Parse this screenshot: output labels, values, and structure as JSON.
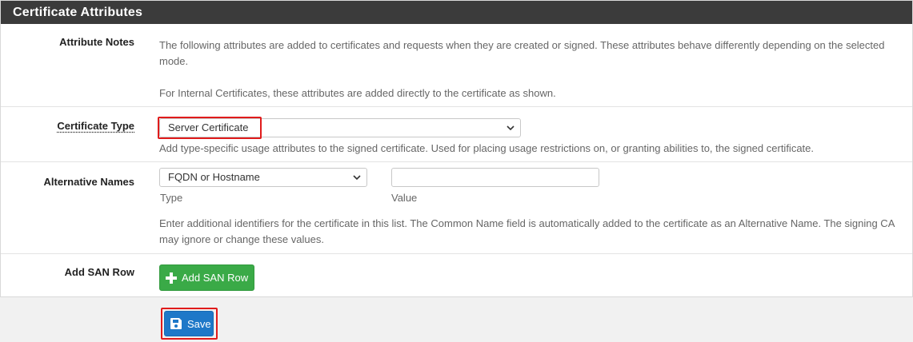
{
  "panel": {
    "title": "Certificate Attributes"
  },
  "attribute_notes": {
    "label": "Attribute Notes",
    "text1": "The following attributes are added to certificates and requests when they are created or signed. These attributes behave differently depending on the selected mode.",
    "text2": "For Internal Certificates, these attributes are added directly to the certificate as shown."
  },
  "certificate_type": {
    "label": "Certificate Type",
    "selected": "Server Certificate",
    "help": "Add type-specific usage attributes to the signed certificate. Used for placing usage restrictions on, or granting abilities to, the signed certificate."
  },
  "alternative_names": {
    "label": "Alternative Names",
    "type_selected": "FQDN or Hostname",
    "type_caption": "Type",
    "value": "",
    "value_caption": "Value",
    "help": "Enter additional identifiers for the certificate in this list. The Common Name field is automatically added to the certificate as an Alternative Name. The signing CA may ignore or change these values."
  },
  "add_san_row": {
    "label": "Add SAN Row",
    "button": "Add SAN Row"
  },
  "save": {
    "button": "Save"
  },
  "colors": {
    "heading_bg": "#3b3b3b",
    "green_button": "#3aaa47",
    "blue_button": "#1e78c8",
    "highlight": "#e01b1b"
  },
  "icons": {
    "add": "plus-icon",
    "save": "floppy-disk-icon",
    "select": "chevron-down-icon"
  }
}
